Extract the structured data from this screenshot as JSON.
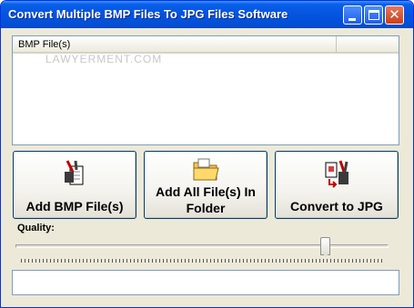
{
  "window": {
    "title": "Convert Multiple BMP Files To JPG Files Software"
  },
  "titlebar_buttons": [
    "minimize-icon",
    "maximize-icon",
    "close-icon"
  ],
  "listview": {
    "columns": [
      "BMP File(s)",
      ""
    ],
    "rows": [],
    "watermark": "LAWYERMENT.COM"
  },
  "buttons": {
    "add_label": "Add BMP File(s)",
    "add_icon": "add-files-icon",
    "addall_line1": "Add All File(s) In",
    "addall_line2": "Folder",
    "addall_icon": "folder-icon",
    "convert_label": "Convert to JPG",
    "convert_icon": "convert-icon"
  },
  "quality": {
    "label": "Quality:",
    "value_fraction": 0.84
  },
  "status": {
    "text": ""
  },
  "colors": {
    "titlebar": "#0454e0",
    "window_bg": "#ece9d8",
    "close_button": "#c8401c"
  }
}
